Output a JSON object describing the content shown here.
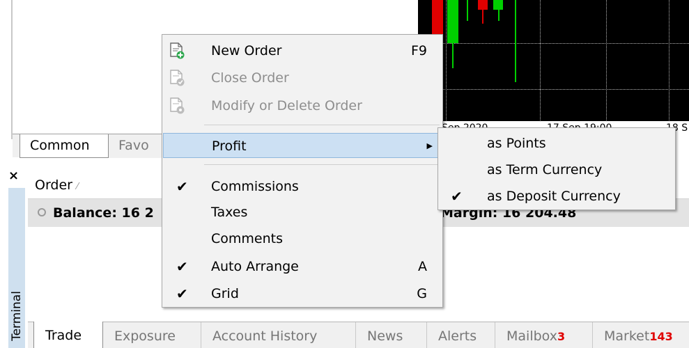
{
  "navigator": {
    "tabs": [
      "Common",
      "Favo"
    ]
  },
  "chart": {
    "x_axis_labels": [
      "Sep 2020",
      "17 Sep 19:00",
      "18 S"
    ],
    "colors": {
      "background": "#000000",
      "bull": "#00d000",
      "bear": "#e00000",
      "grid": "#bcbcbc"
    }
  },
  "terminal": {
    "title": "Terminal",
    "close_glyph": "×",
    "order_column": "Order",
    "order_sort_glyph": "⁄",
    "balance_text": "Balance: 16 2",
    "margin_fragment": "Margin: 16 204.48",
    "tabs": [
      {
        "label": "Trade",
        "badge": ""
      },
      {
        "label": "Exposure",
        "badge": ""
      },
      {
        "label": "Account History",
        "badge": ""
      },
      {
        "label": "News",
        "badge": ""
      },
      {
        "label": "Alerts",
        "badge": ""
      },
      {
        "label": "Mailbox",
        "badge": "3"
      },
      {
        "label": "Market",
        "badge": "143"
      }
    ]
  },
  "context_menu": {
    "items": [
      {
        "label": "New Order",
        "shortcut": "F9",
        "icon": "new-order-icon",
        "enabled": true
      },
      {
        "label": "Close Order",
        "shortcut": "",
        "icon": "close-order-icon",
        "enabled": false
      },
      {
        "label": "Modify or Delete Order",
        "shortcut": "",
        "icon": "modify-order-icon",
        "enabled": false
      },
      {
        "label": "Profit",
        "shortcut": "",
        "submenu": true,
        "highlighted": true
      },
      {
        "label": "Commissions",
        "shortcut": "",
        "checked": true
      },
      {
        "label": "Taxes",
        "shortcut": "",
        "checked": false
      },
      {
        "label": "Comments",
        "shortcut": "",
        "checked": false
      },
      {
        "label": "Auto Arrange",
        "shortcut": "A",
        "checked": true
      },
      {
        "label": "Grid",
        "shortcut": "G",
        "checked": true
      }
    ],
    "check_glyph": "✔",
    "submenu_arrow": "▶"
  },
  "profit_submenu": {
    "items": [
      {
        "label": "as Points",
        "checked": false
      },
      {
        "label": "as Term Currency",
        "checked": false
      },
      {
        "label": "as Deposit Currency",
        "checked": true
      }
    ]
  }
}
